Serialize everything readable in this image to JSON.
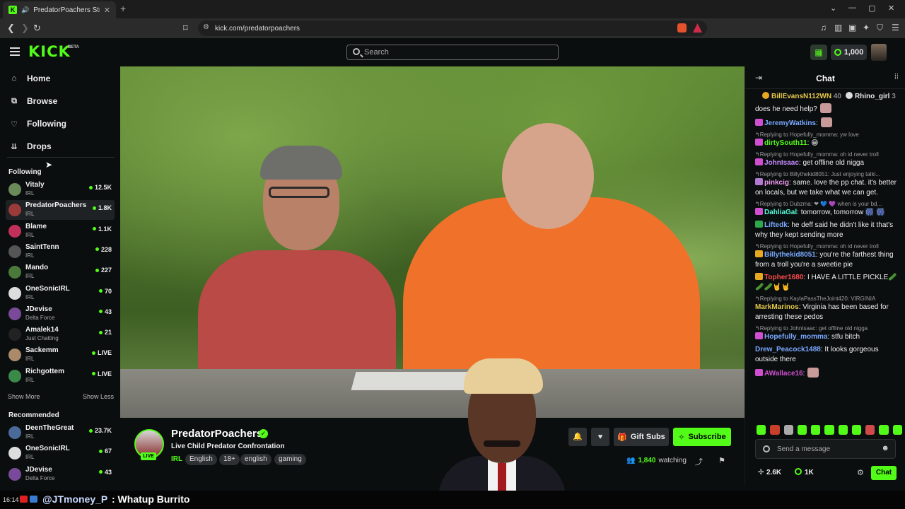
{
  "browser": {
    "tab_title": "PredatorPoachers Stream - W",
    "url": "kick.com/predatorpoachers"
  },
  "header": {
    "logo": "KICK",
    "logo_badge": "BETA",
    "search_placeholder": "Search",
    "points": "1,000"
  },
  "sidebar": {
    "nav": [
      {
        "label": "Home",
        "icon": "home-icon"
      },
      {
        "label": "Browse",
        "icon": "browse-icon"
      },
      {
        "label": "Following",
        "icon": "heart-icon"
      },
      {
        "label": "Drops",
        "icon": "drops-icon"
      }
    ],
    "following_title": "Following",
    "following": [
      {
        "name": "Vitaly",
        "category": "IRL",
        "count": "12.5K",
        "avatar_color": "#6a8a5a"
      },
      {
        "name": "PredatorPoachers",
        "category": "IRL",
        "count": "1.8K",
        "avatar_color": "#9a3a3a"
      },
      {
        "name": "Blame",
        "category": "IRL",
        "count": "1.1K",
        "avatar_color": "#c0305a"
      },
      {
        "name": "SaintTenn",
        "category": "IRL",
        "count": "228",
        "avatar_color": "#555555"
      },
      {
        "name": "Mando",
        "category": "IRL",
        "count": "227",
        "avatar_color": "#4a7a3a"
      },
      {
        "name": "OneSonicIRL",
        "category": "IRL",
        "count": "70",
        "avatar_color": "#dddddd"
      },
      {
        "name": "JDevise",
        "category": "Delta Force",
        "count": "43",
        "avatar_color": "#7a4a9a"
      },
      {
        "name": "Amalek14",
        "category": "Just Chatting",
        "count": "21",
        "avatar_color": "#222222"
      },
      {
        "name": "Sackemm",
        "category": "IRL",
        "count": "LIVE",
        "avatar_color": "#aa8a6a"
      },
      {
        "name": "Richgottem",
        "category": "IRL",
        "count": "LIVE",
        "avatar_color": "#3a8a4a"
      }
    ],
    "show_more": "Show More",
    "show_less": "Show Less",
    "recommended_title": "Recommended",
    "recommended": [
      {
        "name": "DeenTheGreat",
        "category": "IRL",
        "count": "23.7K",
        "avatar_color": "#4a6a9a"
      },
      {
        "name": "OneSonicIRL",
        "category": "IRL",
        "count": "67",
        "avatar_color": "#dddddd"
      },
      {
        "name": "JDevise",
        "category": "Delta Force",
        "count": "43",
        "avatar_color": "#7a4a9a"
      }
    ]
  },
  "channel": {
    "name": "PredatorPoachers",
    "live_label": "LIVE",
    "stream_title": "Live Child Predator Confrontation",
    "category": "IRL",
    "tags": [
      "English",
      "18+",
      "english",
      "gaming"
    ],
    "gift_label": "Gift Subs",
    "subscribe_label": "Subscribe",
    "viewers": "1,840",
    "watching_label": "watching"
  },
  "chat": {
    "title": "Chat",
    "pinned": [
      {
        "name": "BillEvansN112WN",
        "count": "40"
      },
      {
        "name": "Rhino_girl",
        "count": "3"
      }
    ],
    "messages": [
      {
        "reply": "",
        "badge": "",
        "user": "",
        "user_color": "#eeeeee",
        "text": "does he need help?",
        "emote": true
      },
      {
        "reply": "",
        "badge": "#d04fd0",
        "user": "JeremyWatkins",
        "user_color": "#7aa8ff",
        "text": ":",
        "emote": true
      },
      {
        "reply": "Replying to Hopefully_momma: yw love",
        "badge": "#d04fd0",
        "user": "dirtySouth11",
        "user_color": "#53fc18",
        "text": ": 😁",
        "emote": false
      },
      {
        "reply": "Replying to Hopefully_momma: oh id never troll",
        "badge": "#d04fd0",
        "user": "JohnIsaac",
        "user_color": "#c58cff",
        "text": ": get offline old nigga",
        "emote": false
      },
      {
        "reply": "Replying to Billythekid8051: Just enjoying talki...",
        "badge": "#b07ad0",
        "user": "pinkcig",
        "user_color": "#f29cf0",
        "text": ": same. love the pp chat. it's better on locals, but we take what we can get.",
        "emote": false
      },
      {
        "reply": "Replying to Dubzma: ❤ 💙 💜 when is your bd...",
        "badge": "#d04fd0",
        "user": "DahliaGal",
        "user_color": "#53fcd8",
        "text": ": tomorrow, tomorrow 🎆 🎆",
        "emote": false
      },
      {
        "reply": "",
        "badge": "#2da84a",
        "user": "Liftedk",
        "user_color": "#7aa8ff",
        "text": ": he deff said he didn't like it that's why they kept sending more",
        "emote": false
      },
      {
        "reply": "Replying to Hopefully_momma: oh id never troll",
        "badge": "#e6a820",
        "user": "Billythekid8051",
        "user_color": "#7aa8ff",
        "text": ": you're the farthest thing from a troll you're a sweetie pie",
        "emote": false
      },
      {
        "reply": "",
        "badge": "#e6a820",
        "user": "Topher1680",
        "user_color": "#ff4a4a",
        "text": ": I HAVE A LITTLE PICKLE🥒 🥒🥒🤘🤘",
        "emote": false
      },
      {
        "reply": "Replying to KaylaPassTheJoint420: VIRGINIA",
        "badge": "",
        "user": "MarkMarinos",
        "user_color": "#e6c84a",
        "text": ": Virginia has been based for arresting these pedos",
        "emote": false
      },
      {
        "reply": "Replying to JohnIsaac: get offline old nigga",
        "badge": "#d04fd0",
        "user": "Hopefully_momma",
        "user_color": "#7aa8ff",
        "text": ": stfu bitch",
        "emote": false
      },
      {
        "reply": "",
        "badge": "",
        "user": "Drew_Peacock1488",
        "user_color": "#7aa8ff",
        "text": ": It looks gorgeous outside there",
        "emote": false
      },
      {
        "reply": "",
        "badge": "#d04fd0",
        "user": "AWallace16",
        "user_color": "#d04fd0",
        "text": ":",
        "emote": true
      }
    ],
    "input_placeholder": "Send a message",
    "footer_likes": "2.6K",
    "footer_points": "1K",
    "send_label": "Chat"
  },
  "overlay": {
    "time": "16:14",
    "user": "@JTmoney_P",
    "message": ": Whatup Burrito"
  }
}
